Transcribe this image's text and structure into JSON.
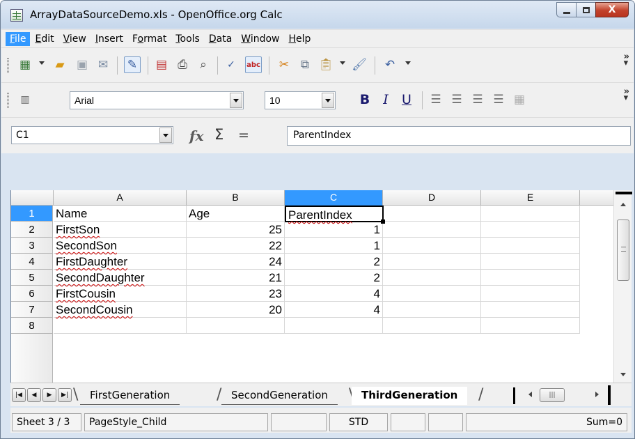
{
  "window": {
    "title": "ArrayDataSourceDemo.xls - OpenOffice.org Calc",
    "close_glyph": "X"
  },
  "menu": {
    "items": [
      {
        "first": "F",
        "rest": "ile",
        "active": true
      },
      {
        "first": "E",
        "rest": "dit"
      },
      {
        "first": "V",
        "rest": "iew"
      },
      {
        "first": "I",
        "rest": "nsert"
      },
      {
        "pre": "F",
        "first": "o",
        "rest": "rmat"
      },
      {
        "first": "T",
        "rest": "ools"
      },
      {
        "first": "D",
        "rest": "ata"
      },
      {
        "first": "W",
        "rest": "indow"
      },
      {
        "first": "H",
        "rest": "elp"
      }
    ]
  },
  "format_toolbar": {
    "font_name": "Arial",
    "font_size": "10",
    "bold": "B",
    "italic": "I",
    "underline": "U"
  },
  "formula_bar": {
    "name_box": "C1",
    "fx": "fx",
    "sum": "Σ",
    "equals": "=",
    "content": "ParentIndex"
  },
  "grid": {
    "columns": [
      "A",
      "B",
      "C",
      "D",
      "E"
    ],
    "selected_column": "C",
    "rows": [
      {
        "num": "1",
        "a": "Name",
        "b": "Age",
        "c": "ParentIndex"
      },
      {
        "num": "2",
        "a": "FirstSon",
        "b": "25",
        "c": "1"
      },
      {
        "num": "3",
        "a": "SecondSon",
        "b": "22",
        "c": "1"
      },
      {
        "num": "4",
        "a": "FirstDaughter",
        "b": "24",
        "c": "2"
      },
      {
        "num": "5",
        "a": "SecondDaughter",
        "b": "21",
        "c": "2"
      },
      {
        "num": "6",
        "a": "FirstCousin",
        "b": "23",
        "c": "4"
      },
      {
        "num": "7",
        "a": "SecondCousin",
        "b": "20",
        "c": "4"
      },
      {
        "num": "8",
        "a": "",
        "b": "",
        "c": ""
      }
    ]
  },
  "sheet_tabs": [
    {
      "label": "FirstGeneration",
      "active": false
    },
    {
      "label": "SecondGeneration",
      "active": false
    },
    {
      "label": "ThirdGeneration",
      "active": true
    }
  ],
  "status_bar": {
    "sheet": "Sheet 3 / 3",
    "page_style": "PageStyle_Child",
    "mode": "STD",
    "sum": "Sum=0"
  }
}
